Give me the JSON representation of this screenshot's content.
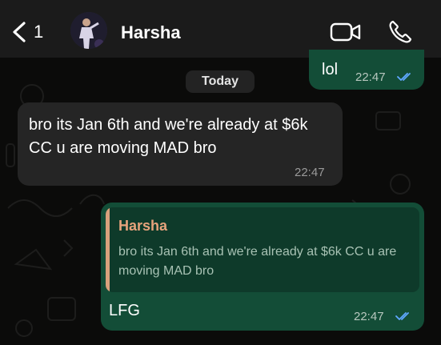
{
  "header": {
    "back_count": "1",
    "contact_name": "Harsha",
    "icons": [
      "back-chevron-icon",
      "video-call-icon",
      "phone-call-icon"
    ]
  },
  "date_separator": "Today",
  "messages": [
    {
      "direction": "outgoing",
      "text": "lol",
      "time": "22:47",
      "status": "read"
    },
    {
      "direction": "incoming",
      "text": "bro its Jan 6th and we're already at $6k CC u are moving MAD bro",
      "time": "22:47"
    },
    {
      "direction": "outgoing",
      "quoted": {
        "author": "Harsha",
        "text": "bro its Jan 6th and we're already at $6k CC u are moving MAD bro"
      },
      "text": "LFG",
      "time": "22:47",
      "status": "read"
    }
  ],
  "colors": {
    "outgoing_bubble": "#134d37",
    "incoming_bubble": "#252525",
    "read_check": "#5fa8ff",
    "quote_author": "#e7a37c"
  }
}
